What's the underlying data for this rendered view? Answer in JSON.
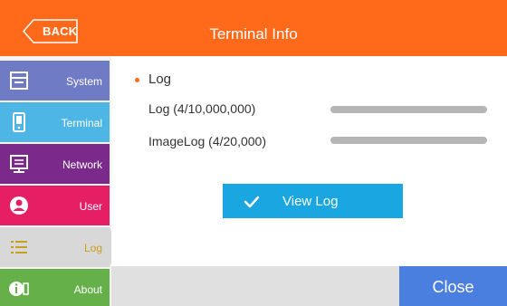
{
  "header": {
    "back_label": "BACK",
    "title": "Terminal Info"
  },
  "sidebar": {
    "items": [
      {
        "label": "System",
        "icon": "system-icon"
      },
      {
        "label": "Terminal",
        "icon": "terminal-icon"
      },
      {
        "label": "Network",
        "icon": "network-icon"
      },
      {
        "label": "User",
        "icon": "user-icon"
      },
      {
        "label": "Log",
        "icon": "log-list-icon",
        "selected": true
      },
      {
        "label": "About",
        "icon": "info-icon"
      }
    ]
  },
  "main": {
    "section_title": "Log",
    "rows": [
      {
        "label": "Log (4/10,000,000)",
        "used": 4,
        "capacity": 10000000
      },
      {
        "label": "ImageLog (4/20,000)",
        "used": 4,
        "capacity": 20000
      }
    ],
    "view_button_label": "View Log"
  },
  "footer": {
    "close_label": "Close"
  },
  "colors": {
    "header": "#ff6a1a",
    "system": "#6f7bc4",
    "terminal": "#4db6e5",
    "network": "#7b2a8c",
    "user": "#e61e63",
    "log_selected": "#d8d8d8",
    "about": "#66b04a",
    "view_button": "#1aa6e0",
    "close_button": "#4a7fe0"
  }
}
